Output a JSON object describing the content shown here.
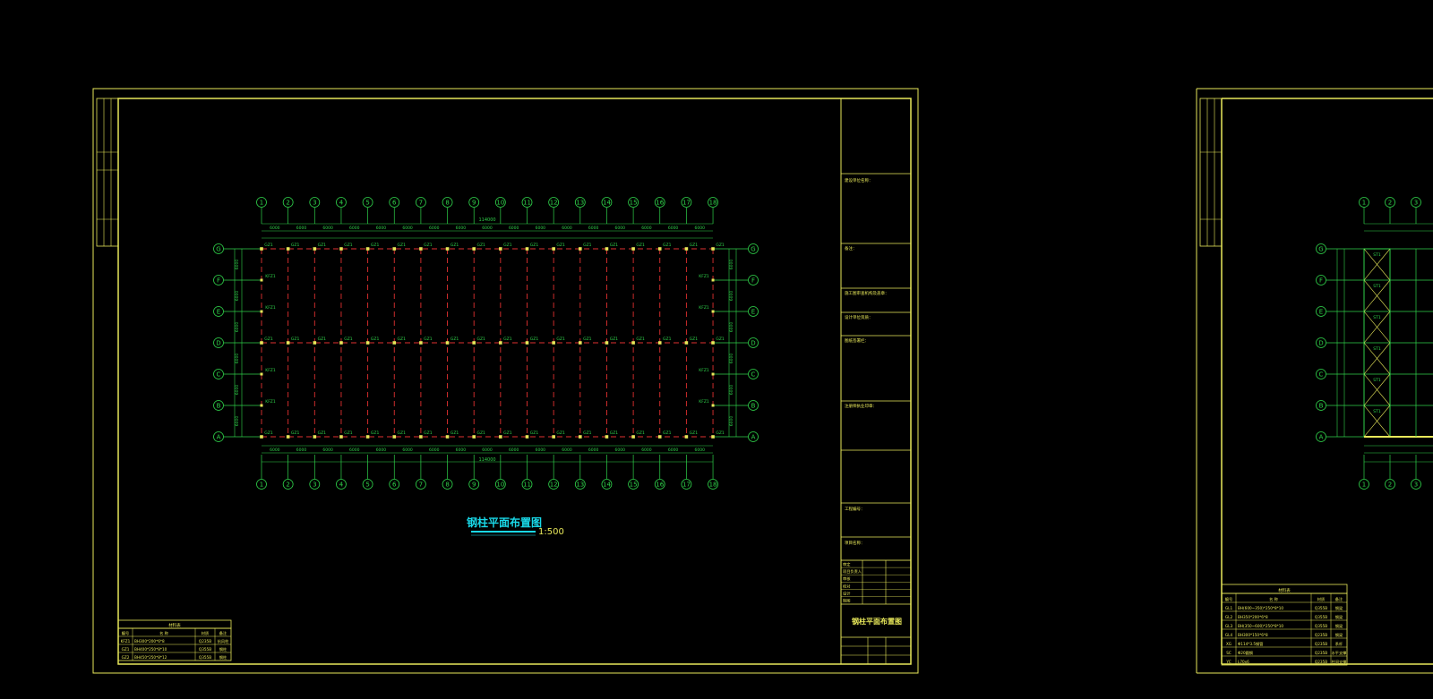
{
  "sheet1": {
    "title": "钢柱平面布置图",
    "scale": "1:500",
    "total_dim_label": "114000",
    "bay_dim_label": "6000",
    "grid_x": [
      "1",
      "2",
      "3",
      "4",
      "5",
      "6",
      "7",
      "8",
      "9",
      "10",
      "11",
      "12",
      "13",
      "14",
      "15",
      "16",
      "17",
      "18"
    ],
    "grid_y": [
      "G",
      "F",
      "E",
      "D",
      "C",
      "B",
      "A"
    ],
    "column_label": "GZ1",
    "wind_column_label": "KFZ1",
    "material_table": {
      "title": "材料表",
      "headers": [
        "编号",
        "名  称",
        "材质",
        "备注"
      ],
      "rows": [
        [
          "KFZ1",
          "BH300*200*6*8",
          "Q235B",
          "抗风柱"
        ],
        [
          "GZ1",
          "BH400*250*8*10",
          "Q355B",
          "钢柱"
        ],
        [
          "GZ2",
          "BH450*250*8*12",
          "Q355B",
          "钢柱"
        ]
      ]
    },
    "title_block": {
      "drawing_name": "钢柱平面布置图",
      "labels": [
        "建设单位名称：",
        "备注：",
        "施工图审查机构及盖章：",
        "设计单位资质：",
        "图纸签署栏：",
        "注册师执业印章：",
        "工程编号：",
        "项目名称："
      ],
      "sign_rows": [
        "审定",
        "项目负责人",
        "审核",
        "校对",
        "设计",
        "制图"
      ]
    }
  },
  "sheet2": {
    "material_table": {
      "title": "材料表",
      "headers": [
        "编号",
        "名  称",
        "材质",
        "备注"
      ],
      "rows": [
        [
          "GL1",
          "BH(600~350)*250*8*10",
          "Q355B",
          "钢梁"
        ],
        [
          "GL2",
          "BH350*200*6*8",
          "Q355B",
          "钢梁"
        ],
        [
          "GL3",
          "BH(350~600)*250*8*10",
          "Q355B",
          "钢梁"
        ],
        [
          "GL4",
          "BH300*150*6*8",
          "Q235B",
          "钢梁"
        ],
        [
          "XG",
          "Φ114*3.5钢管",
          "Q235B",
          "系杆"
        ],
        [
          "SC",
          "Φ20圆钢",
          "Q235B",
          "水平支撑"
        ],
        [
          "YC",
          "L70x6",
          "Q235B",
          "柱间支撑"
        ]
      ]
    },
    "grid_x": [
      "1",
      "2",
      "3"
    ],
    "grid_y": [
      "G",
      "F",
      "E",
      "D",
      "C",
      "B",
      "A"
    ],
    "member_label": "ST1"
  },
  "colors": {
    "frame": "#e8e85a",
    "grid": "#2fd24a",
    "beam": "#e03030",
    "title": "#19d8e8"
  }
}
